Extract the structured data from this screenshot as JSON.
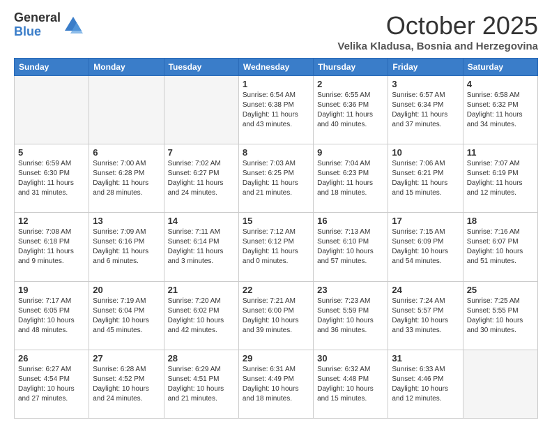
{
  "logo": {
    "general": "General",
    "blue": "Blue",
    "tagline": "GeneralBlue"
  },
  "header": {
    "month": "October 2025",
    "location": "Velika Kladusa, Bosnia and Herzegovina"
  },
  "weekdays": [
    "Sunday",
    "Monday",
    "Tuesday",
    "Wednesday",
    "Thursday",
    "Friday",
    "Saturday"
  ],
  "weeks": [
    [
      {
        "day": "",
        "info": ""
      },
      {
        "day": "",
        "info": ""
      },
      {
        "day": "",
        "info": ""
      },
      {
        "day": "1",
        "info": "Sunrise: 6:54 AM\nSunset: 6:38 PM\nDaylight: 11 hours\nand 43 minutes."
      },
      {
        "day": "2",
        "info": "Sunrise: 6:55 AM\nSunset: 6:36 PM\nDaylight: 11 hours\nand 40 minutes."
      },
      {
        "day": "3",
        "info": "Sunrise: 6:57 AM\nSunset: 6:34 PM\nDaylight: 11 hours\nand 37 minutes."
      },
      {
        "day": "4",
        "info": "Sunrise: 6:58 AM\nSunset: 6:32 PM\nDaylight: 11 hours\nand 34 minutes."
      }
    ],
    [
      {
        "day": "5",
        "info": "Sunrise: 6:59 AM\nSunset: 6:30 PM\nDaylight: 11 hours\nand 31 minutes."
      },
      {
        "day": "6",
        "info": "Sunrise: 7:00 AM\nSunset: 6:28 PM\nDaylight: 11 hours\nand 28 minutes."
      },
      {
        "day": "7",
        "info": "Sunrise: 7:02 AM\nSunset: 6:27 PM\nDaylight: 11 hours\nand 24 minutes."
      },
      {
        "day": "8",
        "info": "Sunrise: 7:03 AM\nSunset: 6:25 PM\nDaylight: 11 hours\nand 21 minutes."
      },
      {
        "day": "9",
        "info": "Sunrise: 7:04 AM\nSunset: 6:23 PM\nDaylight: 11 hours\nand 18 minutes."
      },
      {
        "day": "10",
        "info": "Sunrise: 7:06 AM\nSunset: 6:21 PM\nDaylight: 11 hours\nand 15 minutes."
      },
      {
        "day": "11",
        "info": "Sunrise: 7:07 AM\nSunset: 6:19 PM\nDaylight: 11 hours\nand 12 minutes."
      }
    ],
    [
      {
        "day": "12",
        "info": "Sunrise: 7:08 AM\nSunset: 6:18 PM\nDaylight: 11 hours\nand 9 minutes."
      },
      {
        "day": "13",
        "info": "Sunrise: 7:09 AM\nSunset: 6:16 PM\nDaylight: 11 hours\nand 6 minutes."
      },
      {
        "day": "14",
        "info": "Sunrise: 7:11 AM\nSunset: 6:14 PM\nDaylight: 11 hours\nand 3 minutes."
      },
      {
        "day": "15",
        "info": "Sunrise: 7:12 AM\nSunset: 6:12 PM\nDaylight: 11 hours\nand 0 minutes."
      },
      {
        "day": "16",
        "info": "Sunrise: 7:13 AM\nSunset: 6:10 PM\nDaylight: 10 hours\nand 57 minutes."
      },
      {
        "day": "17",
        "info": "Sunrise: 7:15 AM\nSunset: 6:09 PM\nDaylight: 10 hours\nand 54 minutes."
      },
      {
        "day": "18",
        "info": "Sunrise: 7:16 AM\nSunset: 6:07 PM\nDaylight: 10 hours\nand 51 minutes."
      }
    ],
    [
      {
        "day": "19",
        "info": "Sunrise: 7:17 AM\nSunset: 6:05 PM\nDaylight: 10 hours\nand 48 minutes."
      },
      {
        "day": "20",
        "info": "Sunrise: 7:19 AM\nSunset: 6:04 PM\nDaylight: 10 hours\nand 45 minutes."
      },
      {
        "day": "21",
        "info": "Sunrise: 7:20 AM\nSunset: 6:02 PM\nDaylight: 10 hours\nand 42 minutes."
      },
      {
        "day": "22",
        "info": "Sunrise: 7:21 AM\nSunset: 6:00 PM\nDaylight: 10 hours\nand 39 minutes."
      },
      {
        "day": "23",
        "info": "Sunrise: 7:23 AM\nSunset: 5:59 PM\nDaylight: 10 hours\nand 36 minutes."
      },
      {
        "day": "24",
        "info": "Sunrise: 7:24 AM\nSunset: 5:57 PM\nDaylight: 10 hours\nand 33 minutes."
      },
      {
        "day": "25",
        "info": "Sunrise: 7:25 AM\nSunset: 5:55 PM\nDaylight: 10 hours\nand 30 minutes."
      }
    ],
    [
      {
        "day": "26",
        "info": "Sunrise: 6:27 AM\nSunset: 4:54 PM\nDaylight: 10 hours\nand 27 minutes."
      },
      {
        "day": "27",
        "info": "Sunrise: 6:28 AM\nSunset: 4:52 PM\nDaylight: 10 hours\nand 24 minutes."
      },
      {
        "day": "28",
        "info": "Sunrise: 6:29 AM\nSunset: 4:51 PM\nDaylight: 10 hours\nand 21 minutes."
      },
      {
        "day": "29",
        "info": "Sunrise: 6:31 AM\nSunset: 4:49 PM\nDaylight: 10 hours\nand 18 minutes."
      },
      {
        "day": "30",
        "info": "Sunrise: 6:32 AM\nSunset: 4:48 PM\nDaylight: 10 hours\nand 15 minutes."
      },
      {
        "day": "31",
        "info": "Sunrise: 6:33 AM\nSunset: 4:46 PM\nDaylight: 10 hours\nand 12 minutes."
      },
      {
        "day": "",
        "info": ""
      }
    ]
  ]
}
